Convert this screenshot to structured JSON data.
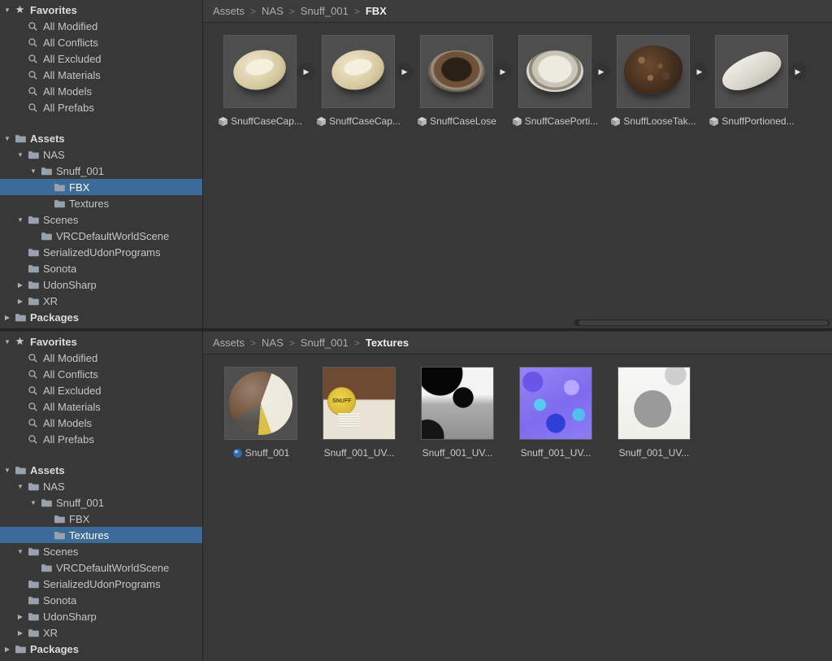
{
  "icons": {
    "star": "★",
    "play": "▶",
    "crumb_sep": ">"
  },
  "colors": {
    "selection": "#3C6A99",
    "background": "#383838",
    "thumbnail_bg": "#4E4E4E"
  },
  "panels": [
    {
      "breadcrumbs": [
        {
          "label": "Assets"
        },
        {
          "label": "NAS"
        },
        {
          "label": "Snuff_001"
        },
        {
          "label": "FBX"
        }
      ],
      "favorites": [
        {
          "label": "Favorites",
          "cls": "lvl0 bold icon-star",
          "arrow": "▼"
        },
        {
          "label": "All Modified",
          "cls": "lvl1 icon-search",
          "arrow": ""
        },
        {
          "label": "All Conflicts",
          "cls": "lvl1 icon-search",
          "arrow": ""
        },
        {
          "label": "All Excluded",
          "cls": "lvl1 icon-search",
          "arrow": ""
        },
        {
          "label": "All Materials",
          "cls": "lvl1 icon-search",
          "arrow": ""
        },
        {
          "label": "All Models",
          "cls": "lvl1 icon-search",
          "arrow": ""
        },
        {
          "label": "All Prefabs",
          "cls": "lvl1 icon-search",
          "arrow": ""
        }
      ],
      "tree": [
        {
          "label": "Assets",
          "cls": "lvl0 bold icon-folder",
          "arrow": "▼"
        },
        {
          "label": "NAS",
          "cls": "lvl1 icon-folder",
          "arrow": "▼"
        },
        {
          "label": "Snuff_001",
          "cls": "lvl2 icon-folder",
          "arrow": "▼"
        },
        {
          "label": "FBX",
          "cls": "lvl3 icon-folder selected",
          "arrow": ""
        },
        {
          "label": "Textures",
          "cls": "lvl3 icon-folder",
          "arrow": ""
        },
        {
          "label": "Scenes",
          "cls": "lvl1 icon-folder",
          "arrow": "▼"
        },
        {
          "label": "VRCDefaultWorldScene",
          "cls": "lvl2 icon-folder",
          "arrow": ""
        },
        {
          "label": "SerializedUdonPrograms",
          "cls": "lvl1 icon-folder",
          "arrow": ""
        },
        {
          "label": "Sonota",
          "cls": "lvl1 icon-folder",
          "arrow": ""
        },
        {
          "label": "UdonSharp",
          "cls": "lvl1 icon-folder",
          "arrow": "▶"
        },
        {
          "label": "XR",
          "cls": "lvl1 icon-folder",
          "arrow": "▶"
        },
        {
          "label": "Packages",
          "cls": "lvl0 bold icon-folder",
          "arrow": "▶"
        }
      ],
      "tiles": [
        {
          "label": "SnuffCaseCap...",
          "thumb": "t-case-tan",
          "cls": "icon-model has-expand",
          "badge": ""
        },
        {
          "label": "SnuffCaseCap...",
          "thumb": "t-case-tan",
          "cls": "icon-model has-expand",
          "badge": ""
        },
        {
          "label": "SnuffCaseLose",
          "thumb": "t-case-brown",
          "cls": "icon-model has-expand",
          "badge": ""
        },
        {
          "label": "SnuffCasePorti...",
          "thumb": "t-case-white",
          "cls": "icon-model has-expand",
          "badge": ""
        },
        {
          "label": "SnuffLooseTak...",
          "thumb": "t-tobacco",
          "cls": "icon-model has-expand",
          "badge": ""
        },
        {
          "label": "SnuffPortioned...",
          "thumb": "t-pouch",
          "cls": "icon-model has-expand",
          "badge": ""
        }
      ]
    },
    {
      "breadcrumbs": [
        {
          "label": "Assets"
        },
        {
          "label": "NAS"
        },
        {
          "label": "Snuff_001"
        },
        {
          "label": "Textures"
        }
      ],
      "favorites": [
        {
          "label": "Favorites",
          "cls": "lvl0 bold icon-star",
          "arrow": "▼"
        },
        {
          "label": "All Modified",
          "cls": "lvl1 icon-search",
          "arrow": ""
        },
        {
          "label": "All Conflicts",
          "cls": "lvl1 icon-search",
          "arrow": ""
        },
        {
          "label": "All Excluded",
          "cls": "lvl1 icon-search",
          "arrow": ""
        },
        {
          "label": "All Materials",
          "cls": "lvl1 icon-search",
          "arrow": ""
        },
        {
          "label": "All Models",
          "cls": "lvl1 icon-search",
          "arrow": ""
        },
        {
          "label": "All Prefabs",
          "cls": "lvl1 icon-search",
          "arrow": ""
        }
      ],
      "tree": [
        {
          "label": "Assets",
          "cls": "lvl0 bold icon-folder",
          "arrow": "▼"
        },
        {
          "label": "NAS",
          "cls": "lvl1 icon-folder",
          "arrow": "▼"
        },
        {
          "label": "Snuff_001",
          "cls": "lvl2 icon-folder",
          "arrow": "▼"
        },
        {
          "label": "FBX",
          "cls": "lvl3 icon-folder",
          "arrow": ""
        },
        {
          "label": "Textures",
          "cls": "lvl3 icon-folder selected",
          "arrow": ""
        },
        {
          "label": "Scenes",
          "cls": "lvl1 icon-folder",
          "arrow": "▼"
        },
        {
          "label": "VRCDefaultWorldScene",
          "cls": "lvl2 icon-folder",
          "arrow": ""
        },
        {
          "label": "SerializedUdonPrograms",
          "cls": "lvl1 icon-folder",
          "arrow": ""
        },
        {
          "label": "Sonota",
          "cls": "lvl1 icon-folder",
          "arrow": ""
        },
        {
          "label": "UdonSharp",
          "cls": "lvl1 icon-folder",
          "arrow": "▶"
        },
        {
          "label": "XR",
          "cls": "lvl1 icon-folder",
          "arrow": "▶"
        },
        {
          "label": "Packages",
          "cls": "lvl0 bold icon-folder",
          "arrow": "▶"
        }
      ],
      "tiles": [
        {
          "label": "Snuff_001",
          "thumb": "t-matball",
          "cls": "icon-material",
          "badge": ""
        },
        {
          "label": "Snuff_001_UV...",
          "thumb": "t-tex-albedo",
          "cls": "",
          "badge": "SNUFF"
        },
        {
          "label": "Snuff_001_UV...",
          "thumb": "t-tex-mask",
          "cls": "",
          "badge": ""
        },
        {
          "label": "Snuff_001_UV...",
          "thumb": "t-tex-normal",
          "cls": "",
          "badge": ""
        },
        {
          "label": "Snuff_001_UV...",
          "thumb": "t-tex-ao",
          "cls": "",
          "badge": ""
        }
      ]
    }
  ]
}
